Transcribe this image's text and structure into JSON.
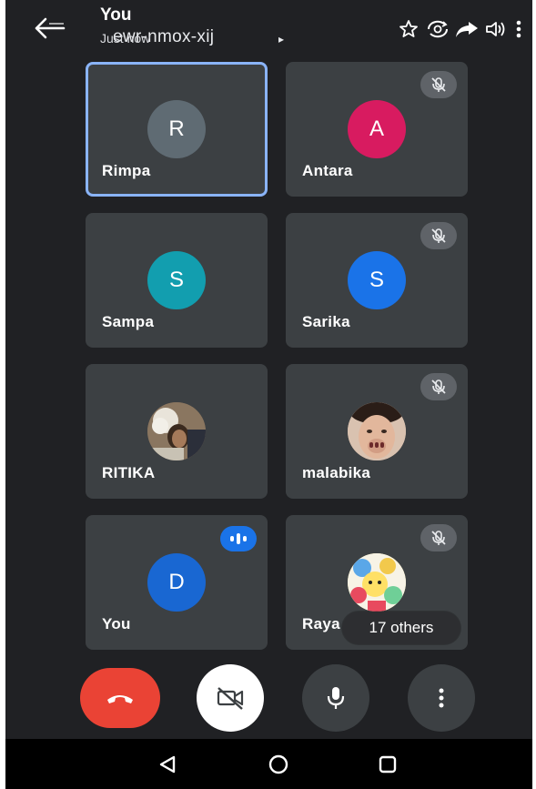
{
  "header": {
    "overlay_name": "You",
    "overlay_time": "Just now",
    "meeting_code": "ewr-nmox-xij",
    "chevron": "▸",
    "icons": [
      "back-arrow-icon",
      "star-icon",
      "switch-camera-icon",
      "share-icon",
      "speaker-icon",
      "more-vert-icon"
    ]
  },
  "participants": [
    {
      "name": "Rimpa",
      "initial": "R",
      "avatar_color": "#5f6b73",
      "muted": false,
      "active": true
    },
    {
      "name": "Antara",
      "initial": "A",
      "avatar_color": "#d81b60",
      "muted": true,
      "active": false
    },
    {
      "name": "Sampa",
      "initial": "S",
      "avatar_color": "#129eaf",
      "muted": false,
      "active": false
    },
    {
      "name": "Sarika",
      "initial": "S",
      "avatar_color": "#1a73e8",
      "muted": true,
      "active": false
    },
    {
      "name": "RITIKA",
      "initial": "",
      "avatar_color": "#7a6a55",
      "muted": false,
      "active": false,
      "photo": true
    },
    {
      "name": "malabika",
      "initial": "",
      "avatar_color": "#c9a58e",
      "muted": true,
      "active": false,
      "photo": true
    },
    {
      "name": "You",
      "initial": "D",
      "avatar_color": "#1967d2",
      "muted": false,
      "active": false,
      "speaking": true
    },
    {
      "name": "Raya",
      "initial": "",
      "avatar_color": "#e8d34a",
      "muted": true,
      "active": false,
      "photo": true
    }
  ],
  "others_label": "17 others",
  "controls": {
    "end_call": "end-call-icon",
    "camera": "camera-off-icon",
    "mic": "mic-icon",
    "more": "more-vert-icon"
  },
  "colors": {
    "background": "#202124",
    "tile": "#3c4043",
    "active_border": "#8ab4f8",
    "end_call": "#ea4335",
    "speaking": "#1a73e8"
  }
}
